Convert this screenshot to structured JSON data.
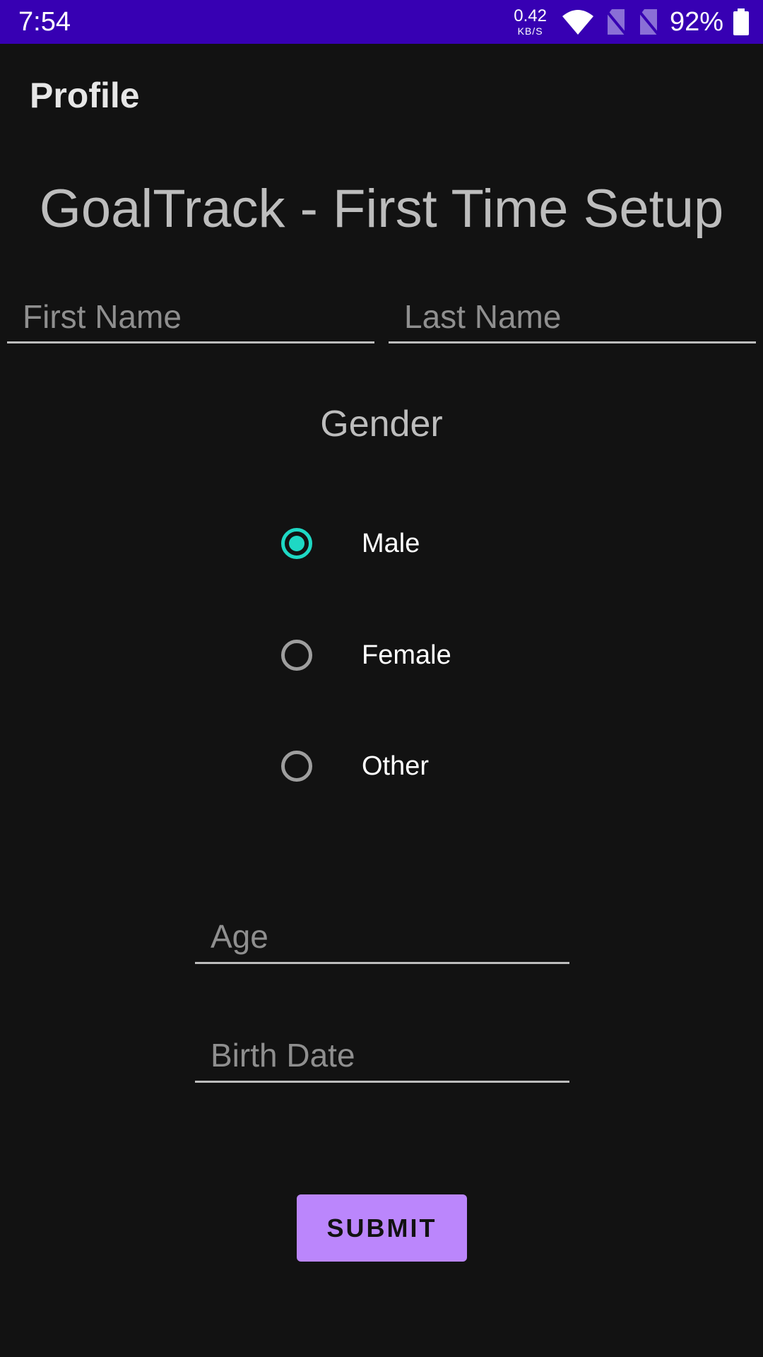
{
  "status_bar": {
    "time": "7:54",
    "net_speed_value": "0.42",
    "net_speed_unit": "KB/S",
    "battery": "92%",
    "icons": [
      "wifi-icon",
      "no-sim-icon",
      "no-sim-icon",
      "battery-icon"
    ]
  },
  "app_bar": {
    "title": "Profile"
  },
  "heading": "GoalTrack - First Time Setup",
  "form": {
    "first_name": {
      "placeholder": "First Name",
      "value": ""
    },
    "last_name": {
      "placeholder": "Last Name",
      "value": ""
    },
    "gender": {
      "label": "Gender",
      "selected": "Male",
      "options": [
        {
          "label": "Male",
          "checked": true
        },
        {
          "label": "Female",
          "checked": false
        },
        {
          "label": "Other",
          "checked": false
        }
      ]
    },
    "age": {
      "placeholder": "Age",
      "value": ""
    },
    "birth_date": {
      "placeholder": "Birth Date",
      "value": ""
    },
    "submit_label": "SUBMIT"
  },
  "colors": {
    "status_bar": "#3700b3",
    "background": "#121212",
    "accent_radio": "#1ed8c4",
    "button": "#bb86fc"
  }
}
